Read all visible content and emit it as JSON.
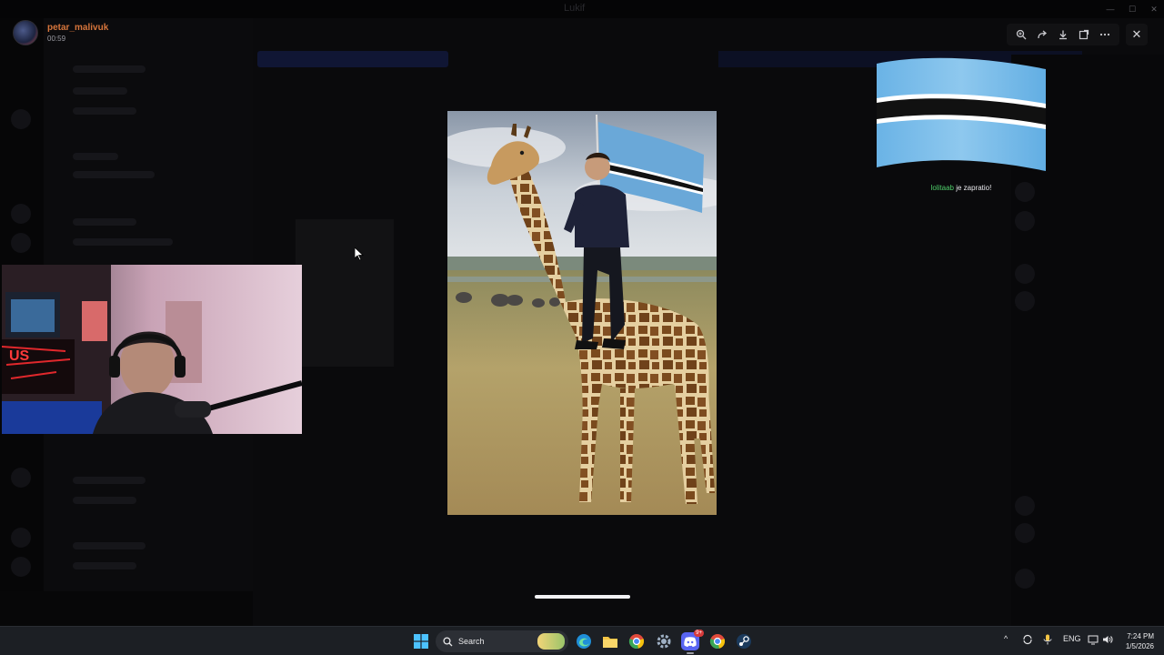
{
  "window": {
    "title": "Lukif"
  },
  "header": {
    "username": "petar_malivuk",
    "elapsed": "00:59"
  },
  "viewer": {
    "toolbar_icons": [
      "zoom-in-icon",
      "forward-icon",
      "download-icon",
      "open-external-icon",
      "more-icon"
    ],
    "close_icon": "close-icon"
  },
  "overlay": {
    "who": "lolitaab",
    "action": " je zapratio!",
    "flag": {
      "top": "#6ab3e6",
      "stripe_white": "#ffffff",
      "stripe_black": "#111111"
    }
  },
  "taskbar": {
    "search_label": "Search",
    "language": "ENG",
    "time": "7:24 PM",
    "date": "1/5/2026",
    "discord_badge": "9+"
  }
}
